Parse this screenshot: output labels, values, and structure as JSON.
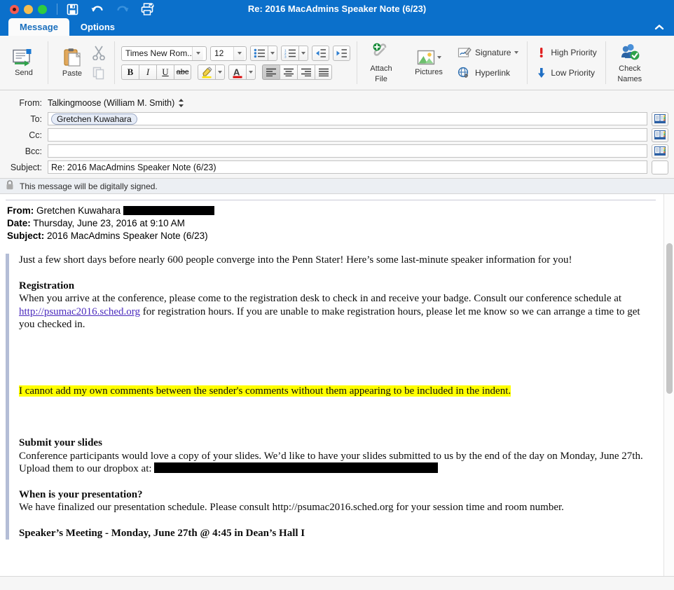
{
  "window": {
    "title": "Re: 2016 MacAdmins Speaker Note (6/23)",
    "traffic": {
      "close": "close-button",
      "minimize": "minimize-button",
      "maximize": "maximize-button"
    },
    "quick_actions": [
      {
        "name": "save-icon",
        "glyph": "save"
      },
      {
        "name": "undo-icon",
        "glyph": "undo"
      },
      {
        "name": "redo-icon",
        "glyph": "redo"
      },
      {
        "name": "print-icon",
        "glyph": "print"
      }
    ],
    "accent_color": "#0b70cb"
  },
  "tabs": [
    {
      "label": "Message",
      "active": true
    },
    {
      "label": "Options",
      "active": false
    }
  ],
  "ribbon": {
    "send_label": "Send",
    "paste_label": "Paste",
    "copy_label": "copy-icon",
    "cut_label": "cut-icon",
    "font_family": "Times New Rom...",
    "font_size": "12",
    "bullets_label": "bulleted-list",
    "numbering_label": "numbered-list",
    "decrease_indent_label": "decrease-indent",
    "increase_indent_label": "increase-indent",
    "bold_label": "B",
    "italic_label": "I",
    "underline_label": "U",
    "strike_label": "abc",
    "highlight_label": "highlight-color",
    "font_color_label": "A",
    "align_left_label": "align-left",
    "align_center_label": "align-center",
    "align_right_label": "align-right",
    "align_justify_label": "align-justify",
    "attach_file_label_1": "Attach",
    "attach_file_label_2": "File",
    "pictures_label": "Pictures",
    "signature_label": "Signature",
    "hyperlink_label": "Hyperlink",
    "high_priority_label": "High Priority",
    "low_priority_label": "Low Priority",
    "check_names_label_1": "Check",
    "check_names_label_2": "Names"
  },
  "compose": {
    "from_label": "From:",
    "from_value": "Talkingmoose (William M. Smith)",
    "to_label": "To:",
    "to_token": "Gretchen Kuwahara",
    "cc_label": "Cc:",
    "cc_value": "",
    "bcc_label": "Bcc:",
    "bcc_value": "",
    "subject_label": "Subject:",
    "subject_value": "Re: 2016 MacAdmins Speaker Note (6/23)",
    "signed_notice": "This message will be digitally signed."
  },
  "quoted_header": {
    "from_key": "From:",
    "from_value": "Gretchen Kuwahara",
    "date_key": "Date:",
    "date_value": "Thursday, June 23, 2016 at 9:10 AM",
    "subject_key": "Subject:",
    "subject_value": "2016 MacAdmins Speaker Note (6/23)"
  },
  "body": {
    "intro": "Just a few short days before nearly 600 people converge into the Penn Stater!  Here’s some last-minute speaker information for you!",
    "registration_heading": "Registration",
    "registration_text_1": "When you arrive at the conference, please come to the registration desk to check in and receive your badge.  Consult our conference schedule at ",
    "registration_link": "http://psumac2016.sched.org",
    "registration_text_2": " for registration hours.  If you are unable to make registration hours, please let me know so we can arrange a time to get you checked in.",
    "highlighted_comment": "I cannot add my own comments between the sender's comments without them appearing to be included in the indent.",
    "slides_heading": "Submit your slides",
    "slides_text_1": "Conference participants would love a copy of your slides.  We’d like to have your slides submitted to us by the end of the day on Monday, June 27th.  Upload them to our dropbox at: ",
    "presentation_heading": "When is your presentation?",
    "presentation_text": "We have finalized our presentation schedule. Please consult http://psumac2016.sched.org for your session time and room number.",
    "speakers_meeting": "Speaker’s Meeting - Monday, June 27th @ 4:45 in Dean’s Hall I",
    "highlight_color": "#ffff00",
    "link_color": "#4b2bbd",
    "quote_bar_color": "#b4bdd6"
  }
}
